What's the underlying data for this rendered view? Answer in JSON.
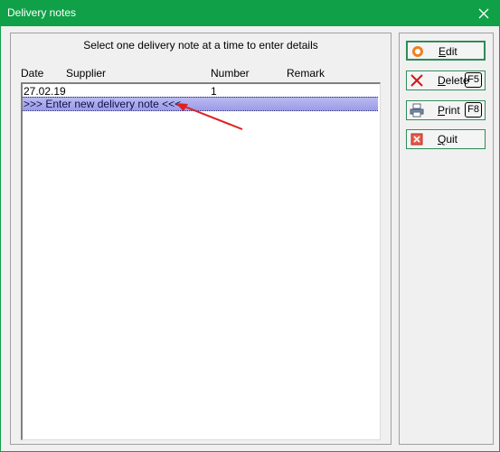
{
  "window": {
    "title": "Delivery notes"
  },
  "instruction": "Select one delivery note at a time to enter details",
  "columns": {
    "date": "Date",
    "supplier": "Supplier",
    "number": "Number",
    "remark": "Remark"
  },
  "rows": [
    {
      "date": "27.02.19",
      "supplier": "",
      "number": "1",
      "remark": ""
    }
  ],
  "new_entry_label": ">>> Enter new delivery note <<<",
  "buttons": {
    "edit": {
      "first": "E",
      "rest": "dit",
      "icon": "edit-ring-icon"
    },
    "delete": {
      "first": "D",
      "rest": "elete",
      "key": "F5",
      "icon": "delete-cross-icon"
    },
    "print": {
      "first": "P",
      "rest": "rint",
      "key": "F8",
      "icon": "printer-icon"
    },
    "quit": {
      "first": "Q",
      "rest": "uit",
      "icon": "quit-box-icon"
    }
  },
  "colors": {
    "titlebar": "#10a048",
    "selection": "#9c9ce6",
    "annotation_arrow": "#e02020"
  }
}
